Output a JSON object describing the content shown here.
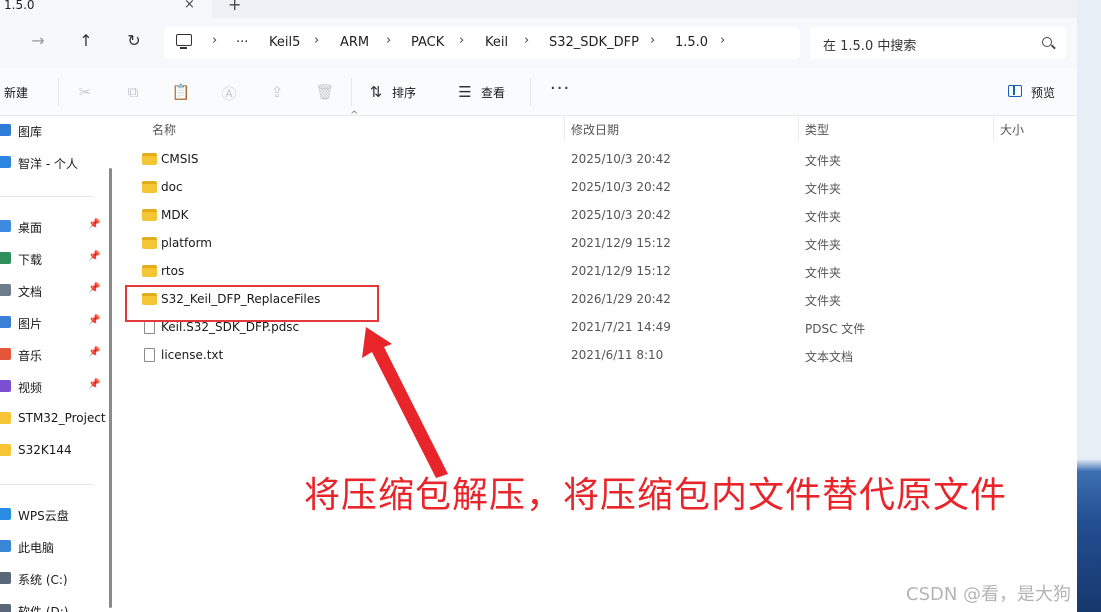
{
  "tab": {
    "title": "1.5.0",
    "close_icon": "×",
    "new_tab_icon": "+"
  },
  "nav": {
    "forward_icon": "→",
    "up_icon": "↑",
    "refresh_icon": "↻"
  },
  "breadcrumb": {
    "overflow": "···",
    "separator": "›",
    "items": [
      "Keil5",
      "ARM",
      "PACK",
      "Keil",
      "S32_SDK_DFP",
      "1.5.0"
    ]
  },
  "search": {
    "placeholder": "在 1.5.0 中搜索"
  },
  "commandbar": {
    "new_label": "新建",
    "sort_label": "排序",
    "view_label": "查看",
    "more_label": "···",
    "preview_label": "预览",
    "icons": {
      "cut": "✂",
      "copy": "⧉",
      "paste": "📋",
      "rename": "Ⓐ",
      "share": "⇪",
      "delete": "🗑",
      "sort": "⇅",
      "view": "☰"
    }
  },
  "sidebar": {
    "items": [
      {
        "label": "图库",
        "icon_color": "#2f7bd8",
        "pinned": false
      },
      {
        "label": "智洋 - 个人",
        "icon_color": "#2c86e0",
        "pinned": false
      },
      {
        "label": "桌面",
        "icon_color": "#3d8ae0",
        "pinned": true
      },
      {
        "label": "下载",
        "icon_color": "#2f8f5a",
        "pinned": true
      },
      {
        "label": "文档",
        "icon_color": "#6f7c8c",
        "pinned": true
      },
      {
        "label": "图片",
        "icon_color": "#3b7fd6",
        "pinned": true
      },
      {
        "label": "音乐",
        "icon_color": "#e4553b",
        "pinned": true
      },
      {
        "label": "视频",
        "icon_color": "#7a4fd1",
        "pinned": true
      },
      {
        "label": "STM32_Project",
        "icon_color": "#f4c534",
        "pinned": false
      },
      {
        "label": "S32K144",
        "icon_color": "#f4c534",
        "pinned": false
      },
      {
        "label": "WPS云盘",
        "icon_color": "#2a8de4",
        "pinned": false
      },
      {
        "label": "此电脑",
        "icon_color": "#3a86d6",
        "pinned": false
      },
      {
        "label": "系统 (C:)",
        "icon_color": "#5a6778",
        "pinned": false
      },
      {
        "label": "软件 (D:)",
        "icon_color": "#5a6778",
        "pinned": false
      }
    ],
    "pin_icon": "📌"
  },
  "columns": {
    "name": "名称",
    "modified": "修改日期",
    "type": "类型",
    "size": "大小",
    "sort_icon": "^"
  },
  "files": [
    {
      "name": "CMSIS",
      "modified": "2025/10/3 20:42",
      "type": "文件夹",
      "kind": "folder"
    },
    {
      "name": "doc",
      "modified": "2025/10/3 20:42",
      "type": "文件夹",
      "kind": "folder"
    },
    {
      "name": "MDK",
      "modified": "2025/10/3 20:42",
      "type": "文件夹",
      "kind": "folder"
    },
    {
      "name": "platform",
      "modified": "2021/12/9 15:12",
      "type": "文件夹",
      "kind": "folder"
    },
    {
      "name": "rtos",
      "modified": "2021/12/9 15:12",
      "type": "文件夹",
      "kind": "folder"
    },
    {
      "name": "S32_Keil_DFP_ReplaceFiles",
      "modified": "2026/1/29 20:42",
      "type": "文件夹",
      "kind": "folder"
    },
    {
      "name": "Keil.S32_SDK_DFP.pdsc",
      "modified": "2021/7/21 14:49",
      "type": "PDSC 文件",
      "kind": "file"
    },
    {
      "name": "license.txt",
      "modified": "2021/6/11 8:10",
      "type": "文本文档",
      "kind": "file"
    }
  ],
  "annotation": {
    "text": "将压缩包解压，将压缩包内文件替代原文件",
    "color": "#e8252a"
  },
  "watermark": "CSDN @看，是大狗"
}
